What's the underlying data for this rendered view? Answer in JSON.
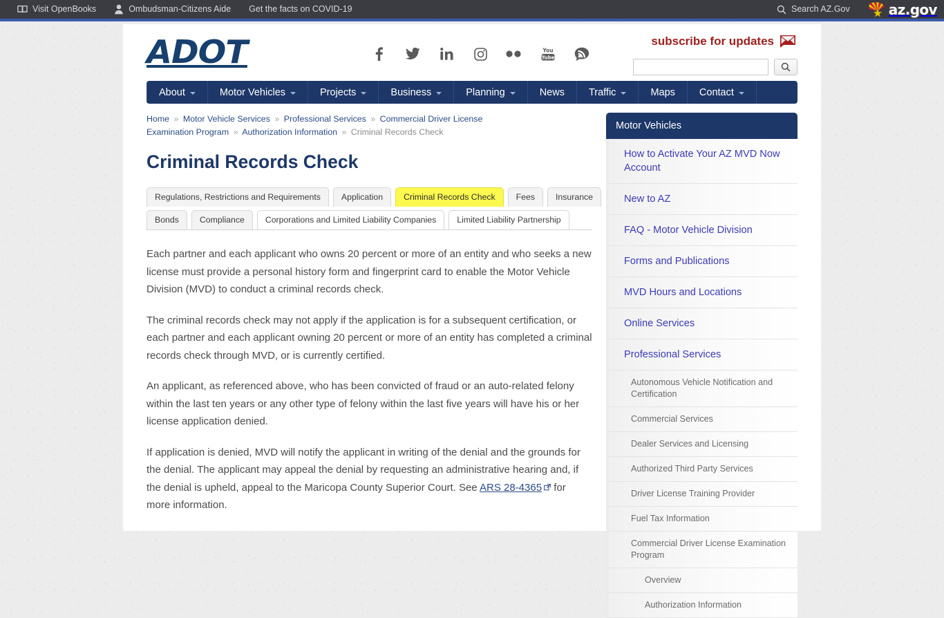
{
  "state_bar": {
    "left_items": [
      {
        "label": "Visit OpenBooks",
        "icon": "book-icon"
      },
      {
        "label": "Ombudsman-Citizens Aide",
        "icon": "person-icon"
      },
      {
        "label": "Get the facts on COVID-19",
        "icon": "none"
      }
    ],
    "search_label": "Search AZ.Gov",
    "search_icon": "search-icon",
    "logo_word": "az.gov",
    "logo_icon": "arizona-flag-icon",
    "bar_color": "#3b3b42",
    "accent_color": "#3c5ba8"
  },
  "header": {
    "logo_text": "ADOT",
    "logo_color": "#17406e",
    "subscribe_label": "subscribe for updates",
    "subscribe_icon": "envelope-icon",
    "subscribe_color": "#9d2020",
    "social": [
      {
        "name": "facebook-icon",
        "label": "Facebook"
      },
      {
        "name": "twitter-icon",
        "label": "Twitter"
      },
      {
        "name": "linkedin-icon",
        "label": "LinkedIn"
      },
      {
        "name": "instagram-icon",
        "label": "Instagram"
      },
      {
        "name": "flickr-icon",
        "label": "Flickr"
      },
      {
        "name": "youtube-icon",
        "label": "YouTube"
      },
      {
        "name": "blog-icon",
        "label": "Blog"
      }
    ],
    "search": {
      "value": "",
      "placeholder": "",
      "button_icon": "search-icon"
    }
  },
  "nav": {
    "items": [
      {
        "label": "About",
        "has_dropdown": true
      },
      {
        "label": "Motor Vehicles",
        "has_dropdown": true
      },
      {
        "label": "Projects",
        "has_dropdown": true
      },
      {
        "label": "Business",
        "has_dropdown": true
      },
      {
        "label": "Planning",
        "has_dropdown": true
      },
      {
        "label": "News",
        "has_dropdown": false
      },
      {
        "label": "Traffic",
        "has_dropdown": true
      },
      {
        "label": "Maps",
        "has_dropdown": false
      },
      {
        "label": "Contact",
        "has_dropdown": true
      }
    ],
    "background": "#1d3768"
  },
  "breadcrumb": {
    "separator": "»",
    "items": [
      {
        "label": "Home",
        "current": false
      },
      {
        "label": "Motor Vehicle Services",
        "current": false
      },
      {
        "label": "Professional Services",
        "current": false
      },
      {
        "label": "Commercial Driver License Examination Program",
        "current": false
      },
      {
        "label": "Authorization Information",
        "current": false
      },
      {
        "label": "Criminal Records Check",
        "current": true
      }
    ]
  },
  "page": {
    "title": "Criminal Records Check",
    "title_color": "#1d3768"
  },
  "tabs": {
    "active_color": "#fbf84f",
    "row1": [
      {
        "label": "Regulations, Restrictions and Requirements",
        "active": false,
        "plain": false
      },
      {
        "label": "Application",
        "active": false,
        "plain": false
      },
      {
        "label": "Criminal Records Check",
        "active": true,
        "plain": false
      },
      {
        "label": "Fees",
        "active": false,
        "plain": false
      },
      {
        "label": "Insurance",
        "active": false,
        "plain": false
      }
    ],
    "row2": [
      {
        "label": "Bonds",
        "active": false,
        "plain": false
      },
      {
        "label": "Compliance",
        "active": false,
        "plain": false
      },
      {
        "label": "Corporations and Limited Liability Companies",
        "active": false,
        "plain": true
      },
      {
        "label": "Limited Liability Partnership",
        "active": false,
        "plain": true
      }
    ]
  },
  "content": {
    "p1": "Each partner and each applicant who owns 20 percent or more of an entity and who seeks a new license must provide a personal history form and fingerprint card to enable the Motor Vehicle Division (MVD) to conduct a criminal records check.",
    "p2": "The criminal records check may not apply if the application is for a subsequent certification, or each partner and each applicant owning 20 percent or more of an entity has completed a criminal records check through MVD, or is currently certified.",
    "p3": "An applicant, as referenced above, who has been convicted of fraud or an auto-related felony within the last ten years or any other type of felony within the last five years will have his or her license application denied.",
    "p4_before": "If application is denied, MVD will notify the applicant in writing of the denial and the grounds for the denial. The applicant may appeal the denial by requesting an administrative hearing and, if the denial is upheld, appeal to the Maricopa County Superior Court. See ",
    "p4_link": "ARS 28-4365",
    "p4_after": " for more information."
  },
  "rail": {
    "header": "Motor Vehicles",
    "items": [
      {
        "label": "How to Activate Your AZ MVD Now Account",
        "level": 0
      },
      {
        "label": "New to AZ",
        "level": 0
      },
      {
        "label": "FAQ - Motor Vehicle Division",
        "level": 0
      },
      {
        "label": "Forms and Publications",
        "level": 0
      },
      {
        "label": "MVD Hours and Locations",
        "level": 0
      },
      {
        "label": "Online Services",
        "level": 0
      },
      {
        "label": "Professional Services",
        "level": 0
      },
      {
        "label": "Autonomous Vehicle Notification and Certification",
        "level": 1
      },
      {
        "label": "Commercial Services",
        "level": 1
      },
      {
        "label": "Dealer Services and Licensing",
        "level": 1
      },
      {
        "label": "Authorized Third Party Services",
        "level": 1
      },
      {
        "label": "Driver License Training Provider",
        "level": 1
      },
      {
        "label": "Fuel Tax Information",
        "level": 1
      },
      {
        "label": "Commercial Driver License Examination Program",
        "level": 1
      },
      {
        "label": "Overview",
        "level": 2
      },
      {
        "label": "Authorization Information",
        "level": 2
      }
    ]
  }
}
